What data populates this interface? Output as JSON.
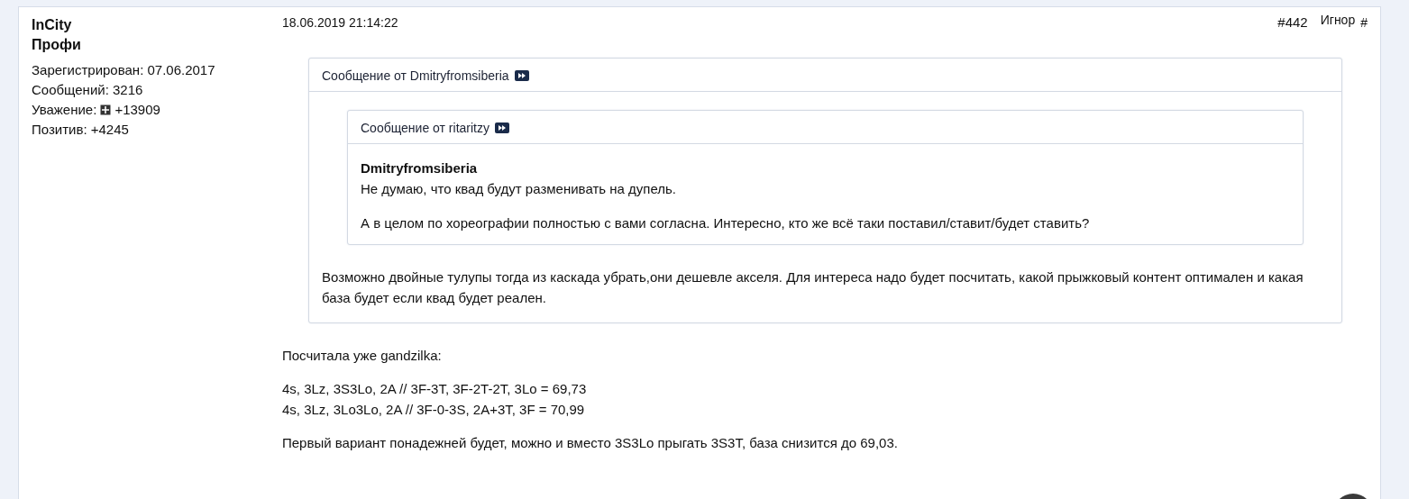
{
  "post": {
    "author": {
      "name": "InCity",
      "rank": "Профи",
      "stats": [
        {
          "kind": "text",
          "label": "Зарегистрирован:",
          "value": "07.06.2017"
        },
        {
          "kind": "text",
          "label": "Сообщений:",
          "value": "3216"
        },
        {
          "kind": "reputation",
          "label": "Уважение:",
          "value": "+13909"
        },
        {
          "kind": "text",
          "label": "Позитив:",
          "value": "+4245"
        }
      ]
    },
    "date": "18.06.2019 21:14:22",
    "number": "#442",
    "ignore_link": "Игнор",
    "permalink": "#",
    "quote": {
      "prefix": "Сообщение от",
      "author": "Dmitryfromsiberia",
      "quote": {
        "prefix": "Сообщение от",
        "author": "ritaritzy",
        "body": [
          {
            "kind": "bold",
            "lines": [
              "Dmitryfromsiberia"
            ]
          },
          {
            "kind": "text",
            "lines": [
              "Не думаю, что квад будут разменивать на дупель."
            ]
          },
          {
            "kind": "text",
            "lines": [
              "А в целом по хореографии полностью с вами согласна. Интересно, кто же всё таки поставил/ставит/будет ставить?"
            ]
          }
        ]
      },
      "body": [
        {
          "kind": "text",
          "lines": [
            "Возможно двойные тулупы тогда из каскада убрать,они дешевле акселя. Для интереса надо будет посчитать, какой прыжковый контент оптимален и какая база будет если квад будет реален."
          ]
        }
      ]
    },
    "body": [
      {
        "kind": "text",
        "lines": [
          "Посчитала уже gandzilka:"
        ]
      },
      {
        "kind": "text",
        "lines": [
          "4s, 3Lz, 3S3Lo, 2A // 3F-3T, 3F-2T-2T, 3Lo = 69,73",
          "4s, 3Lz, 3Lo3Lo, 2A // 3F-0-3S, 2A+3T, 3F = 70,99"
        ]
      },
      {
        "kind": "text",
        "lines": [
          "Первый вариант понадежней будет, можно и вместо 3S3Lo  прыгать 3S3T, база снизится до 69,03."
        ]
      }
    ]
  }
}
